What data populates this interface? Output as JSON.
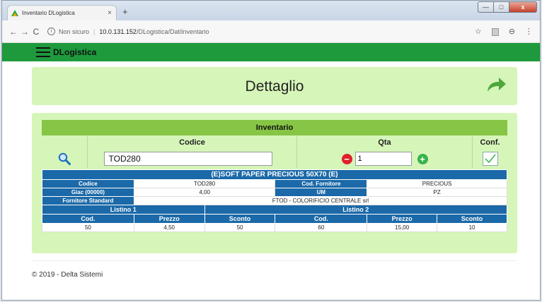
{
  "browser": {
    "tab_title": "Inventario DLogistica",
    "tab_close": "×",
    "new_tab": "+",
    "win_min": "—",
    "win_max": "□",
    "win_close": "x",
    "back": "←",
    "forward": "→",
    "reload": "C",
    "not_secure": "Non sicuro",
    "host": "10.0.131.152",
    "path": "/DLogistica/DatiInventario",
    "star": "☆",
    "menu": "⋮",
    "account": "⊖"
  },
  "navbar": {
    "brand": "DLogistica"
  },
  "header": {
    "title": "Dettaglio"
  },
  "inventory": {
    "title": "Inventario",
    "col_codice": "Codice",
    "col_qta": "Qta",
    "col_conf": "Conf.",
    "codice_value": "TOD280",
    "qta_value": "1",
    "minus": "−",
    "plus": "+"
  },
  "detail": {
    "product_name": "(E)SOFT PAPER PRECIOUS 50X70 (E)",
    "codice_label": "Codice",
    "codice_value": "TOD280",
    "cod_fornitore_label": "Cod. Fornitore",
    "cod_fornitore_value": "PRECIOUS",
    "giac_label": "Giac (00000)",
    "giac_value": "4,00",
    "um_label": "UM",
    "um_value": "PZ",
    "fornitore_label": "Fornitore Standard",
    "fornitore_value": "FTOD - COLORIFICIO CENTRALE srl",
    "listino1": "Listino 1",
    "listino2": "Listino 2",
    "cod": "Cod.",
    "prezzo": "Prezzo",
    "sconto": "Sconto",
    "l1_cod": "50",
    "l1_prezzo": "4,50",
    "l1_sconto": "50",
    "l2_cod": "60",
    "l2_prezzo": "15,00",
    "l2_sconto": "10"
  },
  "footer": {
    "text": "© 2019 - Delta Sistemi"
  },
  "colors": {
    "green_nav": "#1e9a3c",
    "light_green": "#d6f5b9",
    "header_green": "#86c545",
    "blue": "#1b69a8"
  }
}
